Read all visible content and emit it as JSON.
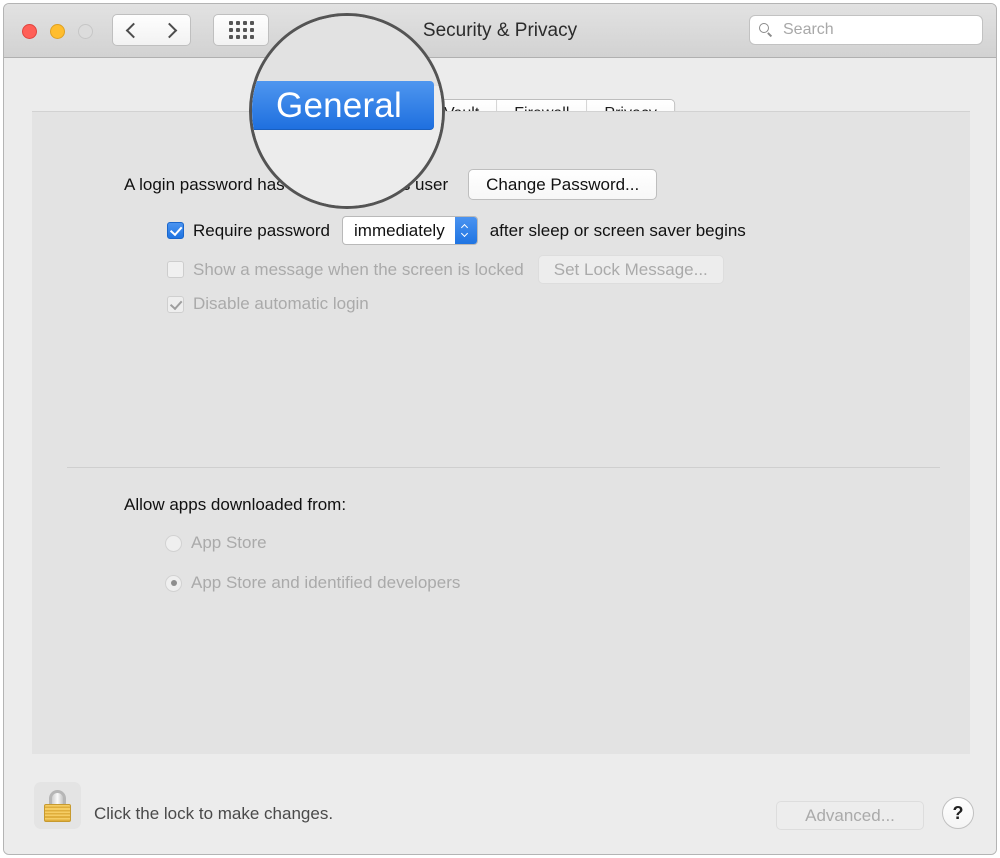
{
  "window": {
    "title": "Security & Privacy",
    "traffic_lights": [
      {
        "name": "close",
        "color": "#ff5f57"
      },
      {
        "name": "minimize",
        "color": "#ffbd2e"
      },
      {
        "name": "zoom",
        "color": "#dcdcdc"
      }
    ]
  },
  "toolbar": {
    "back_icon": "chevron-left-icon",
    "forward_icon": "chevron-right-icon",
    "show_all_icon": "grid-dots-icon",
    "search": {
      "icon": "search-icon",
      "value": "",
      "placeholder": "Search"
    }
  },
  "tabs": [
    {
      "label": "General",
      "selected": true,
      "magnified": true
    },
    {
      "label": "eVault",
      "selected": false,
      "clipped_full_label": "FileVault"
    },
    {
      "label": "Firewall",
      "selected": false
    },
    {
      "label": "Privacy",
      "selected": false
    }
  ],
  "general_pane": {
    "login_password_text": "A login password has been set for this user",
    "change_password_button": "Change Password...",
    "require_password": {
      "checked": true,
      "enabled": true,
      "label": "Require password",
      "popup_value": "immediately",
      "suffix": "after sleep or screen saver begins"
    },
    "show_lock_message": {
      "checked": false,
      "enabled": false,
      "label": "Show a message when the screen is locked",
      "button": "Set Lock Message..."
    },
    "disable_auto_login": {
      "checked": true,
      "enabled": false,
      "label": "Disable automatic login"
    },
    "allow_apps_heading": "Allow apps downloaded from:",
    "allow_apps_options": [
      {
        "label": "App Store",
        "selected": false,
        "enabled": false
      },
      {
        "label": "App Store and identified developers",
        "selected": true,
        "enabled": false
      }
    ]
  },
  "bottom_bar": {
    "lock_icon": "padlock-closed-icon",
    "lock_text": "Click the lock to make changes.",
    "advanced_button": "Advanced...",
    "advanced_enabled": false,
    "help_button": "?"
  },
  "magnifier": {
    "magnified_label": "General",
    "note": "circular loupe overlay magnifying the General tab"
  },
  "colors": {
    "accent_blue": "#1f74e2",
    "window_chrome": "#ececec",
    "panel": "#e3e3e3",
    "lock_gold": "#dfae3c",
    "disabled_text": "#aaaaaa"
  }
}
